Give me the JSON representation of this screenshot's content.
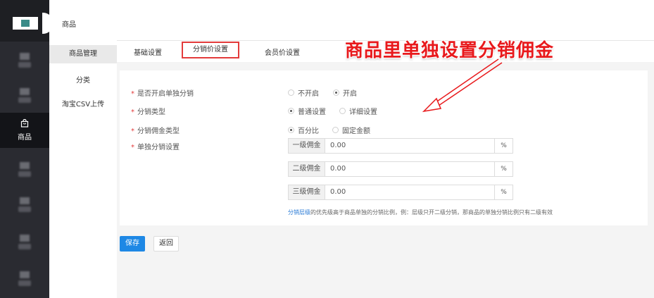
{
  "nav": {
    "active_label": "商品",
    "active_icon": "bag-icon"
  },
  "subnav": {
    "title": "商品",
    "items": [
      {
        "label": "商品管理"
      },
      {
        "label": "分类"
      },
      {
        "label": "淘宝CSV上传"
      }
    ]
  },
  "tabs": [
    {
      "label": "基础设置"
    },
    {
      "label": "分销价设置"
    },
    {
      "label": "会员价设置"
    }
  ],
  "annotation": {
    "text": "商品里单独设置分销佣金",
    "color": "#e8191c"
  },
  "form": {
    "enable": {
      "label": "是否开启单独分销",
      "options": [
        "不开启",
        "开启"
      ],
      "selected": "开启"
    },
    "dist_type": {
      "label": "分销类型",
      "options": [
        "普通设置",
        "详细设置"
      ],
      "selected": "普通设置"
    },
    "commission_type": {
      "label": "分销佣金类型",
      "options": [
        "百分比",
        "固定金额"
      ],
      "selected": "百分比"
    },
    "commission": {
      "label": "单独分销设置",
      "levels": [
        {
          "prefix": "一级佣金",
          "value": "0.00",
          "suffix": "%"
        },
        {
          "prefix": "二级佣金",
          "value": "0.00",
          "suffix": "%"
        },
        {
          "prefix": "三级佣金",
          "value": "0.00",
          "suffix": "%"
        }
      ]
    },
    "hint_link": "分销层级",
    "hint_text": "的优先级高于商品单独的分销比例，例：层级只开二级分销，那商品的单独分销比例只有二级有效"
  },
  "buttons": {
    "save": "保存",
    "back": "返回"
  },
  "colors": {
    "primary": "#1e88e5",
    "sidebar": "#2a2b31",
    "highlight": "#e33b3b"
  }
}
